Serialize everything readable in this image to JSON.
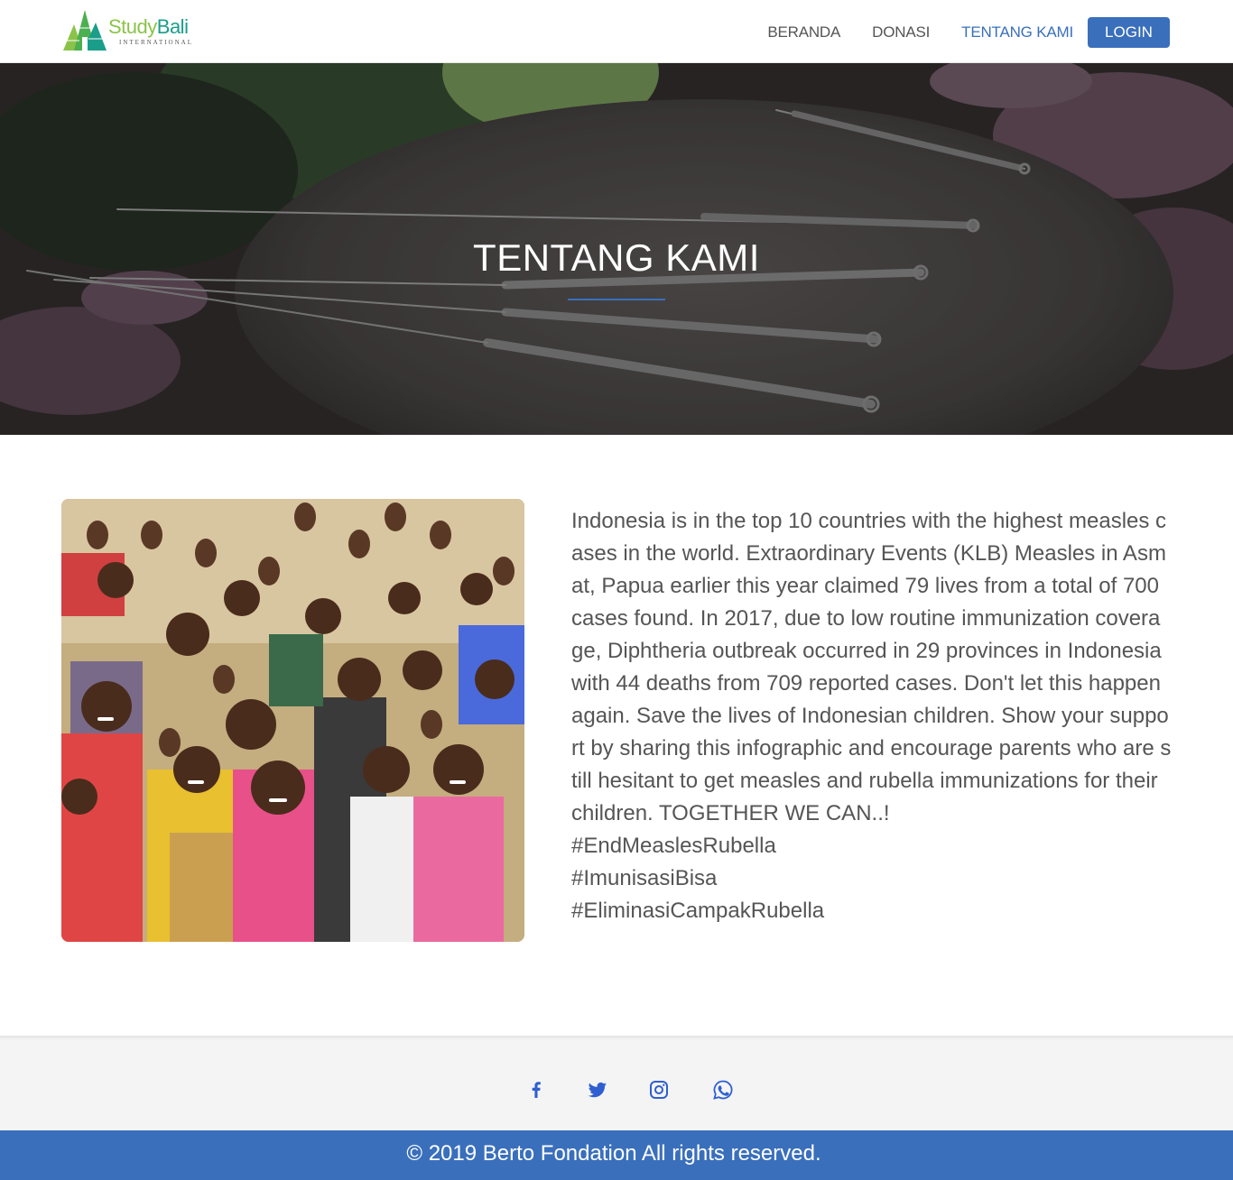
{
  "brand": {
    "name_part1": "Study",
    "name_part2": "Bali",
    "subtitle": "INTERNATIONAL"
  },
  "nav": {
    "items": [
      {
        "label": "BERANDA",
        "active": false
      },
      {
        "label": "DONASI",
        "active": false
      },
      {
        "label": "TENTANG KAMI",
        "active": true
      }
    ],
    "login_label": "LOGIN"
  },
  "hero": {
    "title": "TENTANG KAMI"
  },
  "about": {
    "paragraph": "Indonesia is in the top 10 countries with the highest measles cases in the world. Extraordinary Events (KLB) Measles in Asmat, Papua earlier this year claimed 79 lives from a total of 700 cases found. In 2017, due to low routine immunization coverage, Diphtheria outbreak occurred in 29 provinces in Indonesia with 44 deaths from 709 reported cases. Don't let this happen again. Save the lives of Indonesian children. Show your support by sharing this infographic and encourage parents who are still hesitant to get measles and rubella immunizations for their children. TOGETHER WE CAN..!",
    "hashtags": [
      "#EndMeaslesRubella",
      "#ImunisasiBisa",
      "#EliminasiCampakRubella"
    ]
  },
  "social": {
    "icons": [
      "facebook-icon",
      "twitter-icon",
      "instagram-icon",
      "whatsapp-icon"
    ],
    "color": "#2f5fd0"
  },
  "footer": {
    "copyright": "© 2019 Berto Fondation All rights reserved."
  },
  "colors": {
    "accent": "#3a6fbb",
    "brand_green": "#8bc34a",
    "brand_teal": "#1a9e8a"
  }
}
